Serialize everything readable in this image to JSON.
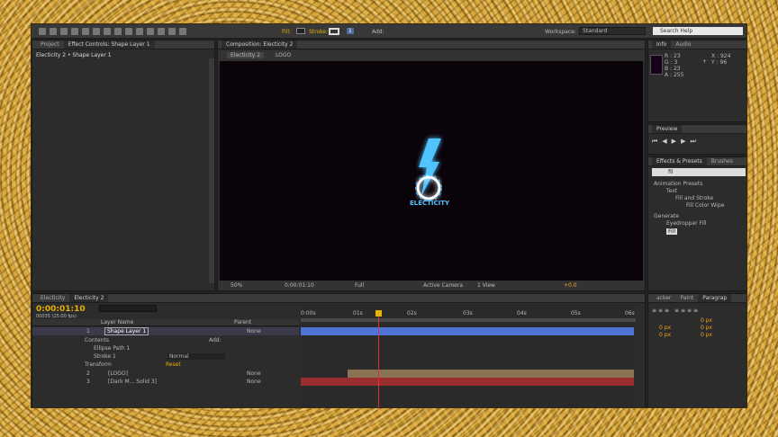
{
  "toolbar": {
    "fill_label": "Fill:",
    "stroke_label": "Stroke:",
    "stroke_width": "1",
    "add_label": "Add:",
    "workspace_label": "Workspace:",
    "workspace_value": "Standard",
    "search_placeholder": "Search Help"
  },
  "left_panel": {
    "tab_project": "Project",
    "tab_effect_controls": "Effect Controls: Shape Layer 1",
    "breadcrumb": "Electicity 2 • Shape Layer 1"
  },
  "composition": {
    "tab": "Composition: Electicity 2",
    "crumb_1": "Electicity 2",
    "crumb_2": "LOGO",
    "logo_text": "ELECTICITY",
    "zoom": "50%",
    "timecode": "0:00:01:10",
    "resolution": "Full",
    "camera": "Active Camera",
    "view": "1 View",
    "exposure": "+0.0"
  },
  "info": {
    "tab_info": "Info",
    "tab_audio": "Audio",
    "r": "R : 23",
    "g": "G : 3",
    "b": "B : 23",
    "a": "A : 255",
    "x": "X : 924",
    "y": "Y : 96"
  },
  "preview": {
    "tab": "Preview"
  },
  "effects": {
    "tab": "Effects & Presets",
    "tab_brushes": "Brushes",
    "search": "fil",
    "tree": [
      "Animation Presets",
      "Text",
      "Fill and Stroke",
      "Fill Color Wipe",
      "Generate",
      "Eyedropper Fill",
      "Fill"
    ]
  },
  "timeline": {
    "tab_1": "Electicity",
    "tab_2": "Electicity 2",
    "timecode": "0:00:01:10",
    "frame_info": "00035 (25.00 fps)",
    "col_layer": "Layer Name",
    "col_parent": "Parent",
    "rows": [
      {
        "num": "1",
        "name": "Shape Layer 1",
        "parent": "None"
      },
      {
        "name": "Contents",
        "extra": "Add:"
      },
      {
        "name": "Ellipse Path 1"
      },
      {
        "name": "Stroke 1",
        "mode": "Normal"
      },
      {
        "name": "Transform",
        "extra": "Reset"
      },
      {
        "num": "2",
        "name": "[LOGO]",
        "parent": "None"
      },
      {
        "num": "3",
        "name": "[Dark M... Solid 3]",
        "parent": "None"
      }
    ],
    "ruler": [
      "0:00s",
      "01s",
      "02s",
      "03s",
      "04s",
      "05s",
      "06s"
    ]
  },
  "right_lower": {
    "tab_tracker": "acker",
    "tab_paint": "Paint",
    "tab_paragraph": "Paragrap",
    "px_values": [
      "0 px",
      "0 px",
      "0 px",
      "0 px",
      "0 px"
    ]
  },
  "colors": {
    "bolt": "#4fc4ff",
    "layer1_bar": "#4e74d8",
    "layer2_bar": "#8a7254",
    "layer3_bar": "#9a2e2e",
    "playhead": "#e8b400"
  }
}
